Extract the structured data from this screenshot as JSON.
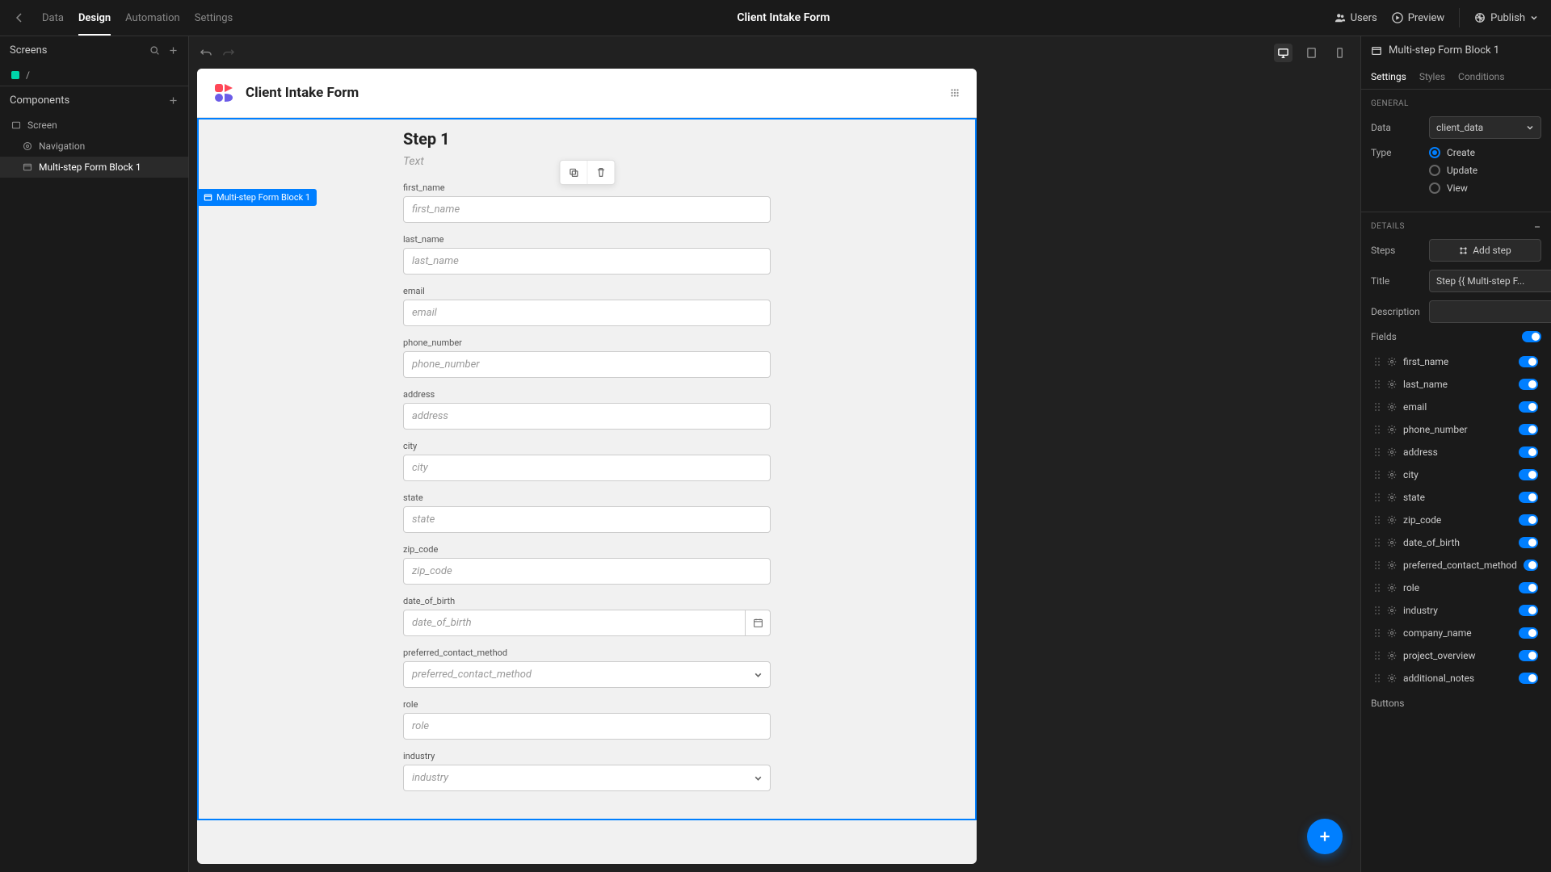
{
  "topbar": {
    "tabs": [
      "Data",
      "Design",
      "Automation",
      "Settings"
    ],
    "active_tab": 1,
    "title": "Client Intake Form",
    "users_label": "Users",
    "preview_label": "Preview",
    "publish_label": "Publish"
  },
  "left": {
    "screens_label": "Screens",
    "root_path": "/",
    "components_label": "Components",
    "tree": [
      {
        "label": "Screen",
        "icon": "screen"
      },
      {
        "label": "Navigation",
        "icon": "nav"
      },
      {
        "label": "Multi-step Form Block 1",
        "icon": "form",
        "selected": true
      }
    ]
  },
  "canvas": {
    "page_title": "Client Intake Form",
    "block_chip": "Multi-step Form Block 1",
    "step_title": "Step 1",
    "step_desc": "Text",
    "fields": [
      {
        "label": "first_name",
        "placeholder": "first_name",
        "type": "text"
      },
      {
        "label": "last_name",
        "placeholder": "last_name",
        "type": "text"
      },
      {
        "label": "email",
        "placeholder": "email",
        "type": "text"
      },
      {
        "label": "phone_number",
        "placeholder": "phone_number",
        "type": "text"
      },
      {
        "label": "address",
        "placeholder": "address",
        "type": "text"
      },
      {
        "label": "city",
        "placeholder": "city",
        "type": "text"
      },
      {
        "label": "state",
        "placeholder": "state",
        "type": "text"
      },
      {
        "label": "zip_code",
        "placeholder": "zip_code",
        "type": "text"
      },
      {
        "label": "date_of_birth",
        "placeholder": "date_of_birth",
        "type": "date"
      },
      {
        "label": "preferred_contact_method",
        "placeholder": "preferred_contact_method",
        "type": "select"
      },
      {
        "label": "role",
        "placeholder": "role",
        "type": "text"
      },
      {
        "label": "industry",
        "placeholder": "industry",
        "type": "select"
      }
    ]
  },
  "right": {
    "header": "Multi-step Form Block 1",
    "tabs": [
      "Settings",
      "Styles",
      "Conditions"
    ],
    "active_tab": 0,
    "general_label": "GENERAL",
    "data_label": "Data",
    "data_value": "client_data",
    "type_label": "Type",
    "type_options": [
      "Create",
      "Update",
      "View"
    ],
    "type_selected": 0,
    "details_label": "DETAILS",
    "steps_label": "Steps",
    "add_step_label": "Add step",
    "title_label": "Title",
    "title_value": "Step {{ Multi-step F...",
    "description_label": "Description",
    "fields_label": "Fields",
    "field_list": [
      "first_name",
      "last_name",
      "email",
      "phone_number",
      "address",
      "city",
      "state",
      "zip_code",
      "date_of_birth",
      "preferred_contact_method",
      "role",
      "industry",
      "company_name",
      "project_overview",
      "additional_notes"
    ],
    "buttons_label": "Buttons"
  }
}
